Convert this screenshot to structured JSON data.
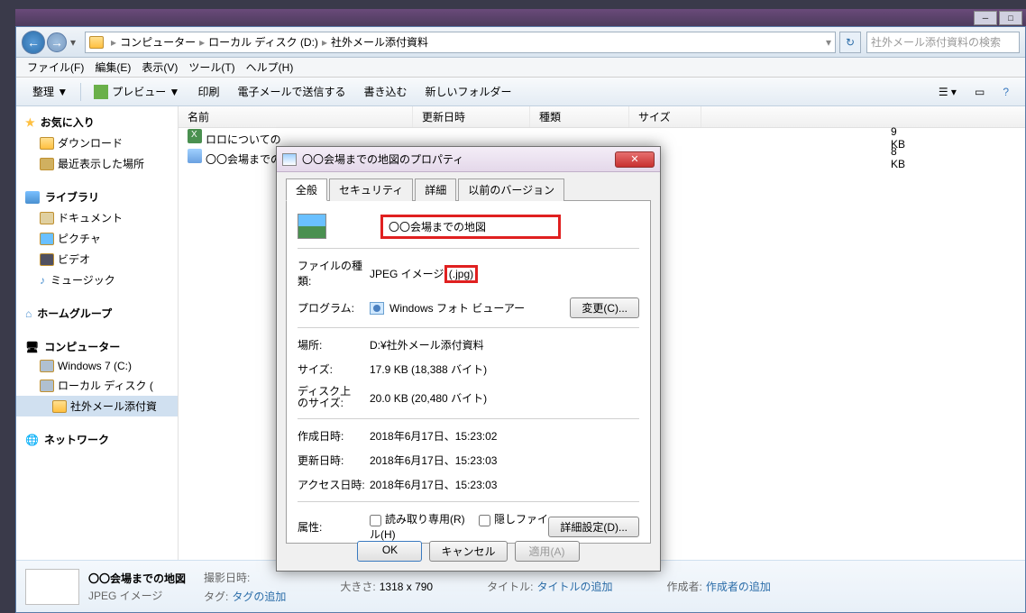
{
  "breadcrumb": {
    "root": "コンピューター",
    "drive": "ローカル ディスク (D:)",
    "folder": "社外メール添付資料"
  },
  "search": {
    "placeholder": "社外メール添付資料の検索"
  },
  "menus": {
    "file": "ファイル(F)",
    "edit": "編集(E)",
    "view": "表示(V)",
    "tools": "ツール(T)",
    "help": "ヘルプ(H)"
  },
  "toolbar": {
    "organize": "整理 ▼",
    "preview": "プレビュー ▼",
    "print": "印刷",
    "email": "電子メールで送信する",
    "burn": "書き込む",
    "newfolder": "新しいフォルダー"
  },
  "columns": {
    "name": "名前",
    "date": "更新日時",
    "type": "種類",
    "size": "サイズ"
  },
  "sidebar": {
    "favorites": "お気に入り",
    "downloads": "ダウンロード",
    "recent": "最近表示した場所",
    "library": "ライブラリ",
    "documents": "ドキュメント",
    "pictures": "ピクチャ",
    "videos": "ビデオ",
    "music": "ミュージック",
    "homegroup": "ホームグループ",
    "computer": "コンピューター",
    "cdrive": "Windows 7 (C:)",
    "ddrive": "ローカル ディスク (",
    "selfolder": "社外メール添付資",
    "network": "ネットワーク"
  },
  "files": {
    "f1name": "ロロについての",
    "f1size": "9 KB",
    "f2name": "〇〇会場までの",
    "f2size": "8 KB"
  },
  "status": {
    "name": "〇〇会場までの地図",
    "type": "JPEG イメージ",
    "datelabel": "撮影日時:",
    "tagslabel": "タグ:",
    "tagsval": "タグの追加",
    "dimlabel": "大きさ:",
    "dimval": "1318 x 790",
    "titlelabel": "タイトル:",
    "titleval": "タイトルの追加",
    "authorlabel": "作成者:",
    "authorval": "作成者の追加"
  },
  "dialog": {
    "title": "〇〇会場までの地図のプロパティ",
    "tabs": {
      "general": "全般",
      "security": "セキュリティ",
      "details": "詳細",
      "prev": "以前のバージョン"
    },
    "filename": "〇〇会場までの地図",
    "labels": {
      "filetype": "ファイルの種類:",
      "program": "プログラム:",
      "location": "場所:",
      "size": "サイズ:",
      "disksize": "ディスク上\nのサイズ:",
      "created": "作成日時:",
      "modified": "更新日時:",
      "accessed": "アクセス日時:",
      "attrs": "属性:"
    },
    "values": {
      "filetype_pre": "JPEG イメージ ",
      "filetype_ext": "(.jpg)",
      "program": "Windows フォト ビューアー",
      "location": "D:¥社外メール添付資料",
      "size": "17.9 KB (18,388 バイト)",
      "disksize": "20.0 KB (20,480 バイト)",
      "created": "2018年6月17日、15:23:02",
      "modified": "2018年6月17日、15:23:03",
      "accessed": "2018年6月17日、15:23:03",
      "readonly": "読み取り専用(R)",
      "hidden": "隠しファイル(H)"
    },
    "buttons": {
      "change": "変更(C)...",
      "advanced": "詳細設定(D)...",
      "ok": "OK",
      "cancel": "キャンセル",
      "apply": "適用(A)"
    }
  }
}
